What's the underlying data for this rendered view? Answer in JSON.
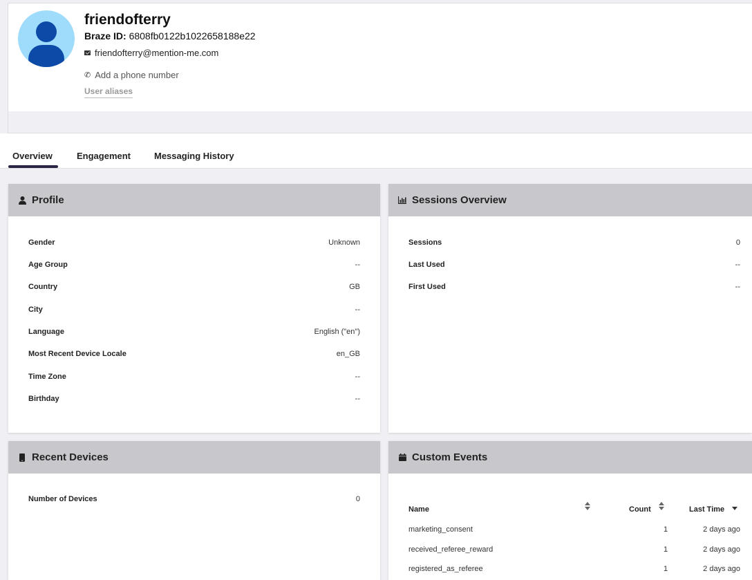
{
  "user": {
    "username": "friendofterry",
    "braze_id_label": "Braze ID:",
    "braze_id": "6808fb0122b1022658188e22",
    "email": "friendofterry@mention-me.com",
    "phone_placeholder": "Add a phone number",
    "aliases_link": "User aliases"
  },
  "tabs": [
    {
      "label": "Overview",
      "active": true
    },
    {
      "label": "Engagement",
      "active": false
    },
    {
      "label": "Messaging History",
      "active": false
    }
  ],
  "profile": {
    "title": "Profile",
    "icon": "user-icon",
    "rows": [
      {
        "key": "Gender",
        "value": "Unknown"
      },
      {
        "key": "Age Group",
        "value": "--"
      },
      {
        "key": "Country",
        "value": "GB"
      },
      {
        "key": "City",
        "value": "--"
      },
      {
        "key": "Language",
        "value": "English (\"en\")"
      },
      {
        "key": "Most Recent Device Locale",
        "value": "en_GB"
      },
      {
        "key": "Time Zone",
        "value": "--"
      },
      {
        "key": "Birthday",
        "value": "--"
      }
    ]
  },
  "sessions": {
    "title": "Sessions Overview",
    "icon": "bar-chart-icon",
    "rows": [
      {
        "key": "Sessions",
        "value": "0"
      },
      {
        "key": "Last Used",
        "value": "--"
      },
      {
        "key": "First Used",
        "value": "--"
      }
    ]
  },
  "devices": {
    "title": "Recent Devices",
    "icon": "mobile-icon",
    "rows": [
      {
        "key": "Number of Devices",
        "value": "0"
      }
    ]
  },
  "custom_events": {
    "title": "Custom Events",
    "icon": "calendar-icon",
    "columns": {
      "name": "Name",
      "count": "Count",
      "last_time": "Last Time"
    },
    "rows": [
      {
        "name": "marketing_consent",
        "count": "1",
        "last_time": "2 days ago"
      },
      {
        "name": "received_referee_reward",
        "count": "1",
        "last_time": "2 days ago"
      },
      {
        "name": "registered_as_referee",
        "count": "1",
        "last_time": "2 days ago"
      }
    ]
  },
  "colors": {
    "avatar_bg": "#9fdcfb",
    "avatar_fg": "#0d4aa8",
    "tab_indicator": "#2b2646",
    "card_header": "#c8c8cc"
  }
}
